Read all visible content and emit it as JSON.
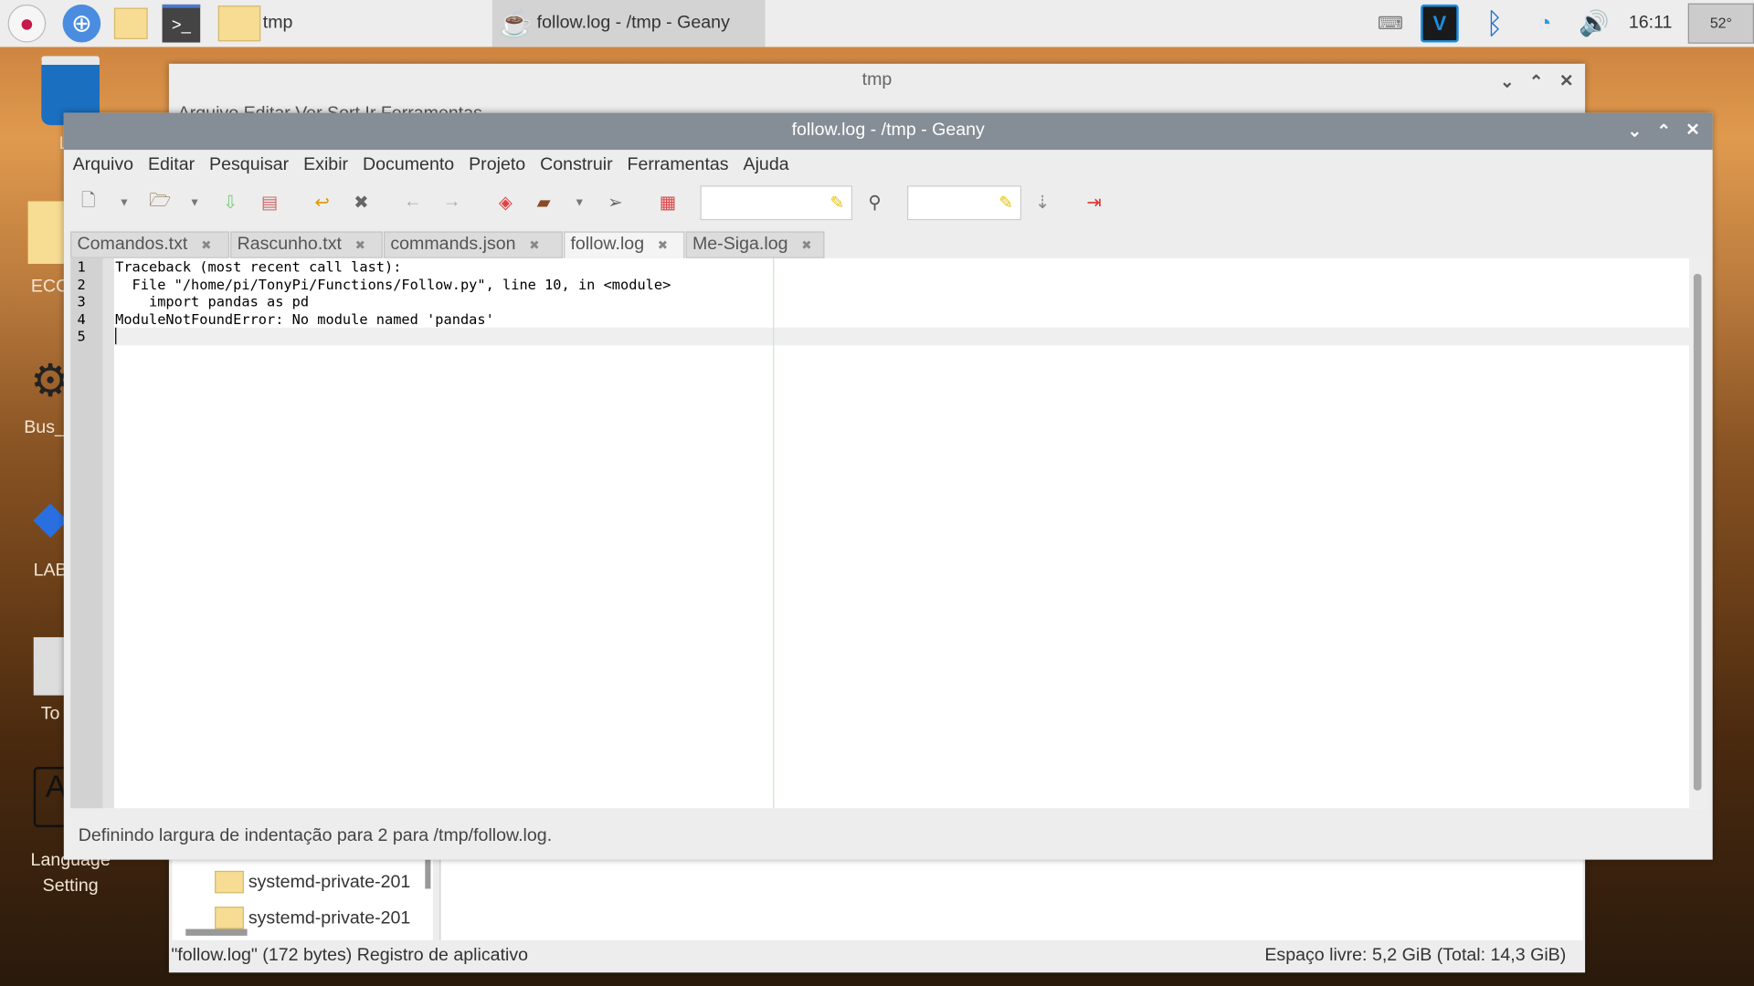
{
  "taskbar": {
    "launchers": [
      "raspberry-menu",
      "web-browser",
      "file-manager",
      "terminal"
    ],
    "folder_task": "tmp",
    "active_task": "follow.log - /tmp - Geany",
    "clock": "16:11",
    "temperature": "52°",
    "tray": [
      "keyboard",
      "vnc",
      "bluetooth",
      "wifi",
      "volume"
    ]
  },
  "desktop": {
    "icons": [
      "Lix",
      "ECO",
      "Bus_S",
      "LAB",
      "To",
      "Language Setting"
    ]
  },
  "file_manager": {
    "title": "tmp",
    "menu": "Arquivo  Editar  Ver  Sort  Ir  Ferramentas",
    "items": [
      "systemd-private-201",
      "systemd-private-201"
    ],
    "status_left": "\"follow.log\" (172 bytes) Registro de aplicativo",
    "status_right": "Espaço livre: 5,2 GiB (Total: 14,3 GiB)"
  },
  "geany": {
    "title": "follow.log - /tmp - Geany",
    "menu": [
      "Arquivo",
      "Editar",
      "Pesquisar",
      "Exibir",
      "Documento",
      "Projeto",
      "Construir",
      "Ferramentas",
      "Ajuda"
    ],
    "search_value": "",
    "goto_value": "",
    "tabs": [
      {
        "label": "Comandos.txt"
      },
      {
        "label": "Rascunho.txt"
      },
      {
        "label": "commands.json"
      },
      {
        "label": "follow.log",
        "active": true
      },
      {
        "label": "Me-Siga.log"
      }
    ],
    "line_numbers": [
      "1",
      "2",
      "3",
      "4",
      "5"
    ],
    "lines": [
      "Traceback (most recent call last):",
      "  File \"/home/pi/TonyPi/Functions/Follow.py\", line 10, in <module>",
      "    import pandas as pd",
      "ModuleNotFoundError: No module named 'pandas'",
      ""
    ],
    "status": "Definindo largura de indentação para 2 para /tmp/follow.log."
  },
  "colors": {
    "titlebar": "#858d96",
    "vnc": "#1a8fe3",
    "bluetooth": "#1a6fd8"
  }
}
